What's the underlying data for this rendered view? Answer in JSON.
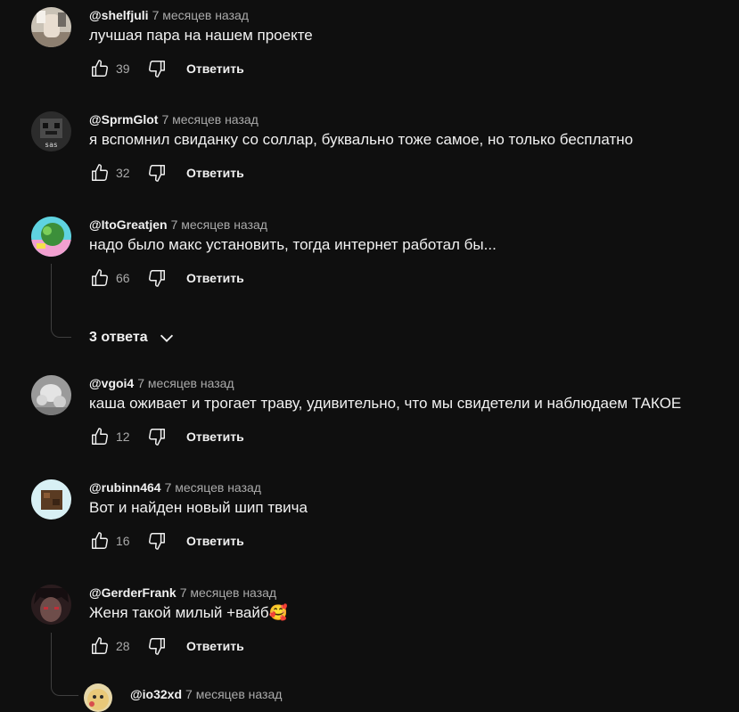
{
  "colors": {
    "background": "#0f0f0f",
    "text_primary": "#f1f1f1",
    "text_secondary": "#aaaaaa",
    "thread_line": "#3f3f3f"
  },
  "comments": [
    {
      "author": "@shelfjuli",
      "time": "7 месяцев назад",
      "text": "лучшая пара на нашем проекте",
      "likes": "39",
      "reply_label": "Ответить",
      "avatar": "photo-avatar"
    },
    {
      "author": "@SprmGlot",
      "time": "7 месяцев назад",
      "text": "я вспомнил свиданку со соллар, буквально тоже самое, но только бесплатно",
      "likes": "32",
      "reply_label": "Ответить",
      "avatar": "pixel-avatar",
      "avatar_caption": "sas"
    },
    {
      "author": "@ItoGreatjen",
      "time": "7 месяцев назад",
      "text": "надо было макс установить, тогда интернет работал бы...",
      "likes": "66",
      "reply_label": "Ответить",
      "avatar": "colorful-avatar"
    },
    {
      "author": "@vgoi4",
      "time": "7 месяцев назад",
      "text": "каша оживает и трогает траву, удивительно, что мы свидетели и наблюдаем ТАКОЕ",
      "likes": "12",
      "reply_label": "Ответить",
      "avatar": "sculpture-avatar"
    },
    {
      "author": "@rubinn464",
      "time": "7 месяцев назад",
      "text": "Вот и найден новый шип твича",
      "likes": "16",
      "reply_label": "Ответить",
      "avatar": "block-avatar"
    },
    {
      "author": "@GerderFrank",
      "time": "7 месяцев назад",
      "text": "Женя такой милый +вайб🥰",
      "likes": "28",
      "reply_label": "Ответить",
      "avatar": "anime-avatar"
    }
  ],
  "replies_toggle": {
    "label": "3 ответа",
    "icon": "chevron-down-icon"
  },
  "reply_preview": {
    "author": "@io32xd",
    "time": "7 месяцев назад",
    "avatar": "cartoon-avatar"
  }
}
